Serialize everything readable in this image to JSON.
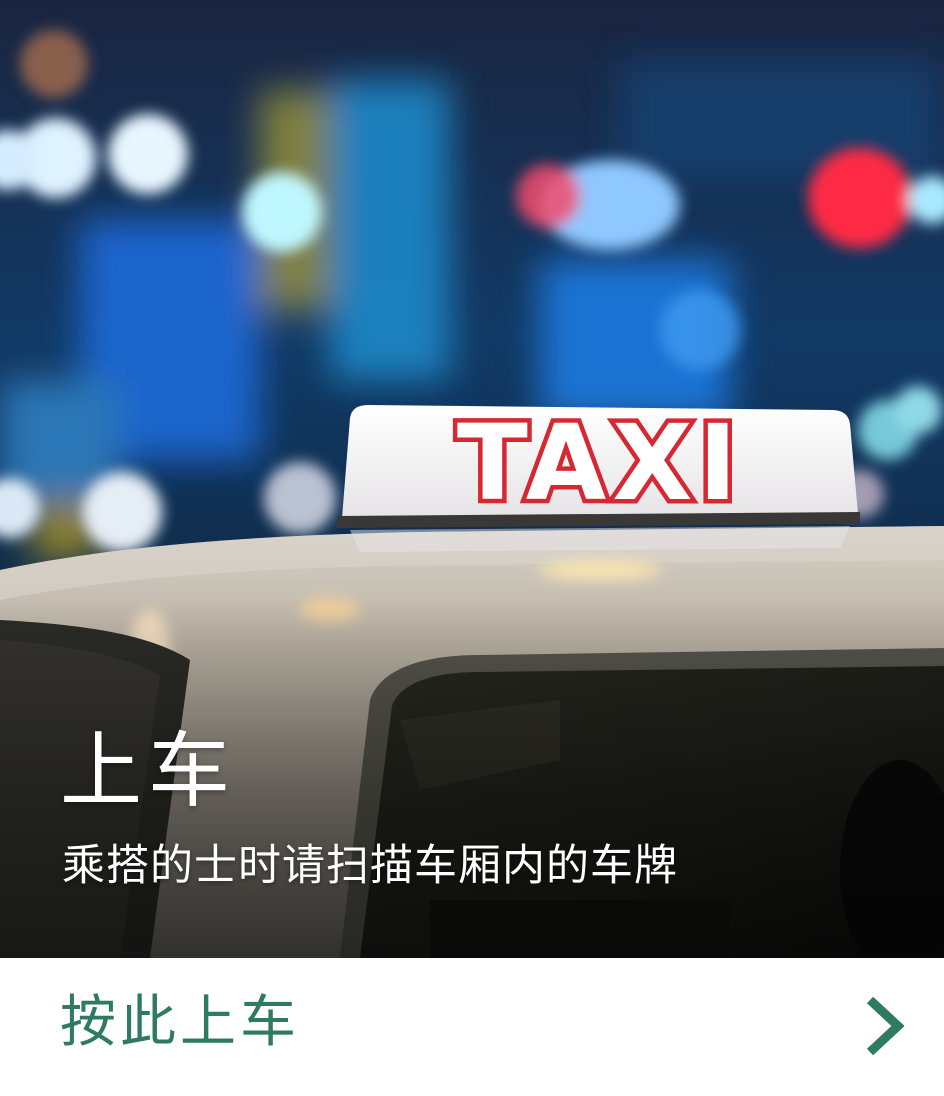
{
  "hero": {
    "sign_text": "TAXI",
    "title": "上车",
    "subtitle": "乘搭的士时请扫描车厢内的车牌"
  },
  "action": {
    "label": "按此上车",
    "icon": "chevron-right-icon"
  },
  "colors": {
    "accent": "#2e7a63",
    "sign_red": "#d62833",
    "text_on_image": "#ffffff"
  }
}
